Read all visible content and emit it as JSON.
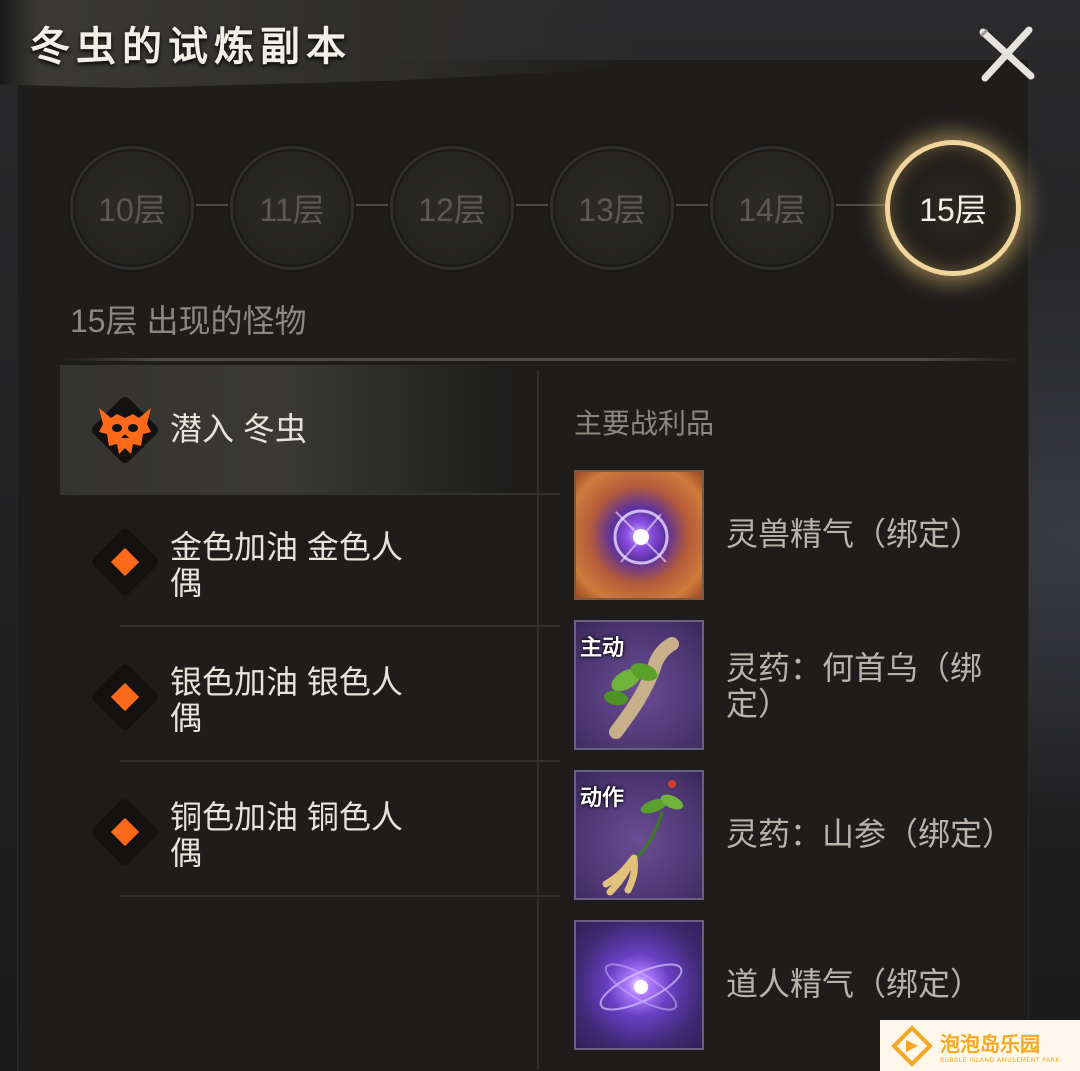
{
  "title": "冬虫的试炼副本",
  "floors": [
    {
      "label": "10层",
      "active": false
    },
    {
      "label": "11层",
      "active": false
    },
    {
      "label": "12层",
      "active": false
    },
    {
      "label": "13层",
      "active": false
    },
    {
      "label": "14层",
      "active": false
    },
    {
      "label": "15层",
      "active": true
    }
  ],
  "section_title": "15层 出现的怪物",
  "monsters": [
    {
      "name": "潜入 冬虫",
      "icon": "demon-skull-icon",
      "selected": true
    },
    {
      "name": "金色加油 金色人偶",
      "icon": "orange-diamond-icon",
      "selected": false
    },
    {
      "name": "银色加油 银色人偶",
      "icon": "orange-diamond-icon",
      "selected": false
    },
    {
      "name": "铜色加油 铜色人偶",
      "icon": "orange-diamond-icon",
      "selected": false
    }
  ],
  "loot_title": "主要战利品",
  "loot": [
    {
      "name": "灵兽精气（绑定）",
      "icon": "beast-essence-icon",
      "tag": ""
    },
    {
      "name": "灵药：何首乌（绑定）",
      "icon": "heshouwu-root-icon",
      "tag": "主动"
    },
    {
      "name": "灵药：山参（绑定）",
      "icon": "ginseng-icon",
      "tag": "动作"
    },
    {
      "name": "道人精气（绑定）",
      "icon": "taoist-essence-icon",
      "tag": ""
    }
  ],
  "watermark": {
    "main": "泡泡岛乐园",
    "sub": "BUBBLE ISLAND AMUSEMENT PARK"
  },
  "colors": {
    "accent": "#ff6a1a",
    "active_ring": "#f1d59a",
    "panel": "#1e1d1c"
  }
}
